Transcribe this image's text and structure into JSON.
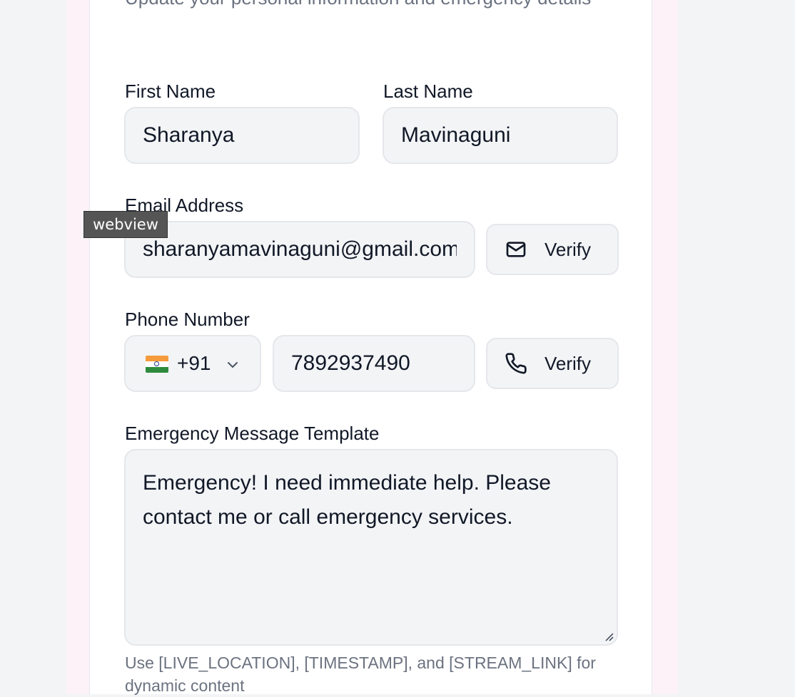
{
  "header": {
    "subtitle": "Update your personal information and emergency details"
  },
  "form": {
    "first_name": {
      "label": "First Name",
      "value": "Sharanya"
    },
    "last_name": {
      "label": "Last Name",
      "value": "Mavinaguni"
    },
    "email": {
      "label": "Email Address",
      "value": "sharanyamavinaguni@gmail.com",
      "verify_label": "Verify"
    },
    "phone": {
      "label": "Phone Number",
      "country_code": "+91",
      "country_flag": "india-flag-icon",
      "value": "7892937490",
      "verify_label": "Verify"
    },
    "message": {
      "label": "Emergency Message Template",
      "value": "Emergency! I need immediate help. Please contact me or call emergency services.",
      "hint": "Use [LIVE_LOCATION], [TIMESTAMP], and [STREAM_LINK] for dynamic content"
    }
  },
  "tooltip": {
    "text": "webview"
  },
  "colors": {
    "background": "#f3f4f6",
    "panel": "#fcf2f8",
    "card": "#ffffff",
    "field": "#f3f4f6",
    "muted_text": "#6b7280"
  }
}
